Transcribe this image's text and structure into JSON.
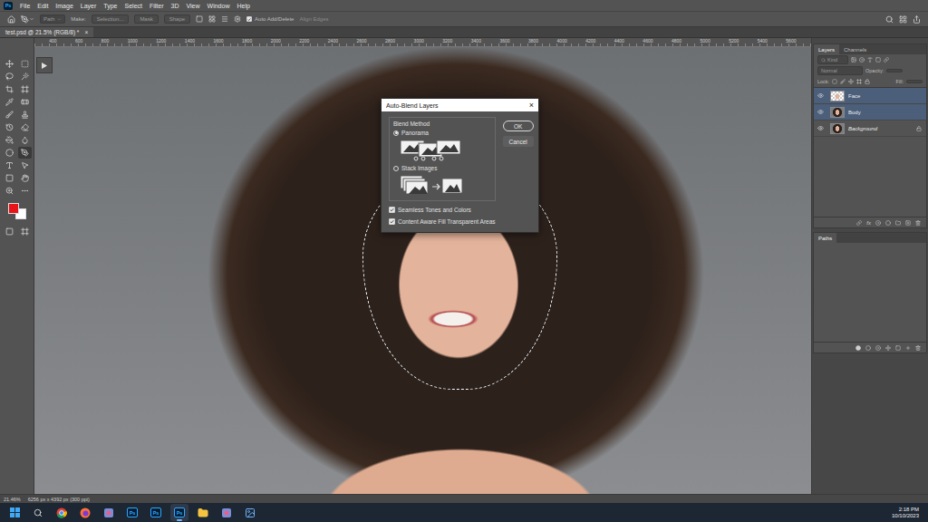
{
  "app": {
    "logo": "Ps"
  },
  "menu": [
    "File",
    "Edit",
    "Image",
    "Layer",
    "Type",
    "Select",
    "Filter",
    "3D",
    "View",
    "Window",
    "Help"
  ],
  "options_bar": {
    "mode": "Path",
    "make_label": "Make:",
    "buttons": [
      "Selection...",
      "Mask",
      "Shape"
    ],
    "auto_add_delete": {
      "label": "Auto Add/Delete",
      "checked": true
    },
    "align_edges": {
      "label": "Align Edges",
      "disabled": true
    }
  },
  "document_tab": {
    "title": "test.psd @ 21.5% (RGB/8) *",
    "close": "×"
  },
  "ruler": [
    "400",
    "600",
    "800",
    "1000",
    "1200",
    "1400",
    "1600",
    "1800",
    "2000",
    "2200",
    "2400",
    "2600",
    "2800",
    "3000",
    "3200",
    "3400",
    "3600",
    "3800",
    "4000",
    "4200",
    "4400",
    "4600",
    "4800",
    "5000",
    "5200",
    "5400",
    "5600"
  ],
  "tools": [
    {
      "selected": false
    },
    {
      "selected": false
    },
    {
      "selected": false
    },
    {
      "selected": false
    },
    {
      "selected": false
    },
    {
      "selected": false
    },
    {
      "selected": false
    },
    {
      "selected": false
    },
    {
      "selected": false
    },
    {
      "selected": false
    },
    {
      "selected": false
    },
    {
      "selected": false
    },
    {
      "selected": false
    },
    {
      "selected": false
    },
    {
      "selected": false
    },
    {
      "selected": true
    },
    {
      "selected": false
    },
    {
      "selected": false
    },
    {
      "selected": false
    },
    {
      "selected": false
    },
    {
      "selected": false
    },
    {
      "selected": false
    },
    {
      "selected": false
    },
    {
      "selected": false
    }
  ],
  "swatches": {
    "foreground": "#e8141a",
    "background": "#ffffff"
  },
  "dialog": {
    "title": "Auto-Blend Layers",
    "close": "×",
    "group_label": "Blend Method",
    "methods": [
      {
        "label": "Panorama",
        "selected": true,
        "kind": "panorama"
      },
      {
        "label": "Stack Images",
        "selected": false,
        "kind": "stack"
      }
    ],
    "options": [
      {
        "label": "Seamless Tones and Colors",
        "checked": true
      },
      {
        "label": "Content Aware Fill Transparent Areas",
        "checked": true
      }
    ],
    "buttons": [
      {
        "label": "OK",
        "default": true
      },
      {
        "label": "Cancel",
        "default": false
      }
    ]
  },
  "layers_panel": {
    "tabs": [
      {
        "label": "Layers",
        "selected": true
      },
      {
        "label": "Channels",
        "selected": false
      }
    ],
    "search": "Kind",
    "blend_mode": "Normal",
    "opacity_label": "Opacity:",
    "lock_label": "Lock:",
    "fill_label": "Fill:",
    "fx": "fx",
    "layers": [
      {
        "name": "Face",
        "selected": true,
        "visible": true,
        "locked": false,
        "kind": "cutout"
      },
      {
        "name": "Body",
        "selected": true,
        "visible": true,
        "locked": false,
        "kind": "photo"
      },
      {
        "name": "Background",
        "selected": false,
        "visible": true,
        "locked": true,
        "kind": "photo"
      }
    ]
  },
  "paths_panel": {
    "tabs": [
      {
        "label": "Paths",
        "selected": true
      }
    ]
  },
  "status_bar": {
    "zoom": "21.46%",
    "size": "6256 px x 4392 px (300 ppi)"
  },
  "taskbar": {
    "apps": [
      {
        "kind": "windows",
        "label": "",
        "active": false
      },
      {
        "kind": "search",
        "label": "",
        "active": false
      },
      {
        "kind": "chrome",
        "label": "",
        "active": false
      },
      {
        "kind": "firefox",
        "label": "",
        "active": false
      },
      {
        "kind": "app",
        "label": "",
        "active": false
      },
      {
        "kind": "ps",
        "label": "Ps",
        "active": false
      },
      {
        "kind": "ps",
        "label": "Ps",
        "active": false
      },
      {
        "kind": "ps",
        "label": "Ps",
        "active": true
      },
      {
        "kind": "folder",
        "label": "",
        "active": false
      },
      {
        "kind": "app",
        "label": "",
        "active": false
      },
      {
        "kind": "photos",
        "label": "",
        "active": false
      }
    ],
    "time": "2:18 PM",
    "date": "10/10/2023"
  }
}
